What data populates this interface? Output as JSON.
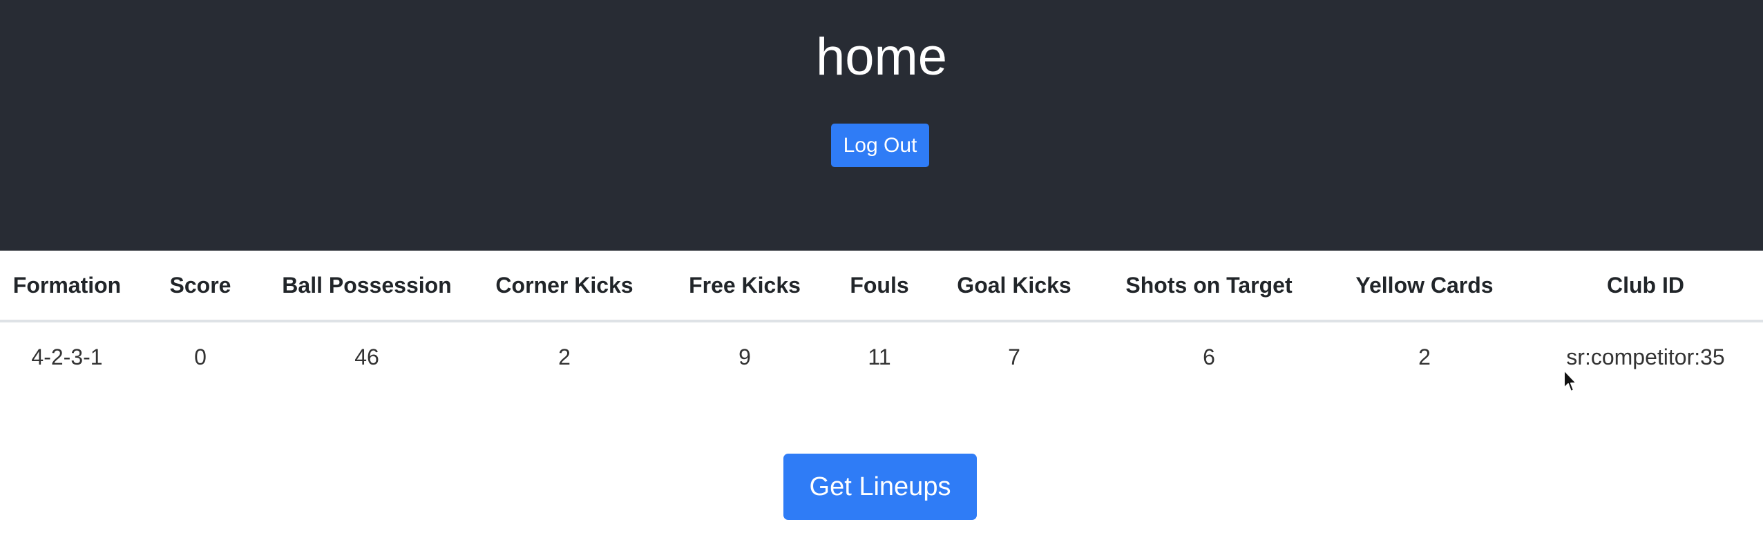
{
  "header": {
    "title": "home",
    "logout_label": "Log Out",
    "background_color": "#282c34"
  },
  "stats_table": {
    "columns": [
      "Formation",
      "Score",
      "Ball Possession",
      "Corner Kicks",
      "Free Kicks",
      "Fouls",
      "Goal Kicks",
      "Shots on Target",
      "Yellow Cards",
      "Club ID"
    ],
    "rows": [
      [
        "4-2-3-1",
        "0",
        "46",
        "2",
        "9",
        "11",
        "7",
        "6",
        "2",
        "sr:competitor:35"
      ]
    ]
  },
  "actions": {
    "get_lineups_label": "Get Lineups"
  },
  "colors": {
    "accent": "#2f7cf6"
  }
}
